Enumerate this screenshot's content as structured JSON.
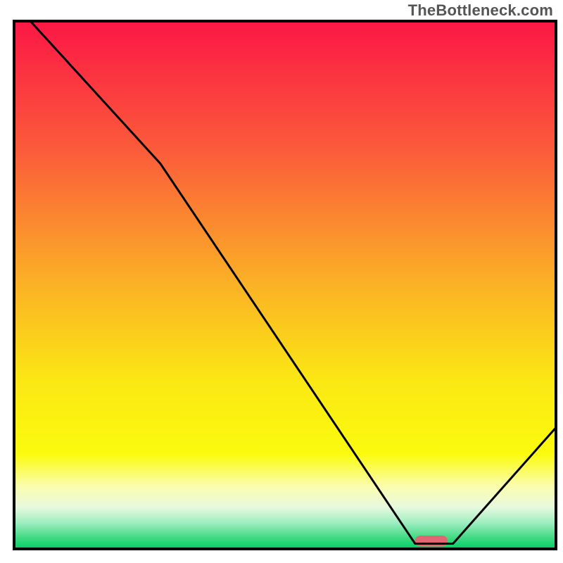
{
  "watermark": "TheBottleneck.com",
  "chart_data": {
    "type": "line",
    "title": "",
    "xlabel": "",
    "ylabel": "",
    "xlim": [
      0,
      100
    ],
    "ylim": [
      0,
      100
    ],
    "grid": false,
    "legend": false,
    "series": [
      {
        "name": "bottleneck-curve",
        "x": [
          3,
          27,
          74,
          81,
          100
        ],
        "y": [
          100,
          73,
          1,
          1,
          23
        ],
        "style": "line",
        "color": "#000000",
        "width": 3
      }
    ],
    "marker": {
      "name": "optimal-range",
      "x_start": 74,
      "x_end": 80,
      "y": 1.5,
      "color": "#e06673",
      "height_pct": 1.0
    },
    "background_gradient": {
      "type": "vertical",
      "stops": [
        {
          "pos": 0.0,
          "color": "#fb1745"
        },
        {
          "pos": 0.25,
          "color": "#fb5d3a"
        },
        {
          "pos": 0.5,
          "color": "#fbb225"
        },
        {
          "pos": 0.68,
          "color": "#fbe714"
        },
        {
          "pos": 0.82,
          "color": "#fbfb0e"
        },
        {
          "pos": 0.88,
          "color": "#fbfcac"
        },
        {
          "pos": 0.92,
          "color": "#e8fade"
        },
        {
          "pos": 0.95,
          "color": "#a0eec1"
        },
        {
          "pos": 0.98,
          "color": "#3dd981"
        },
        {
          "pos": 1.0,
          "color": "#00d062"
        }
      ]
    },
    "frame": {
      "inset_left": 20,
      "inset_right": 10,
      "inset_top": 30,
      "inset_bottom": 20,
      "stroke": "#000000",
      "stroke_width": 4
    }
  }
}
